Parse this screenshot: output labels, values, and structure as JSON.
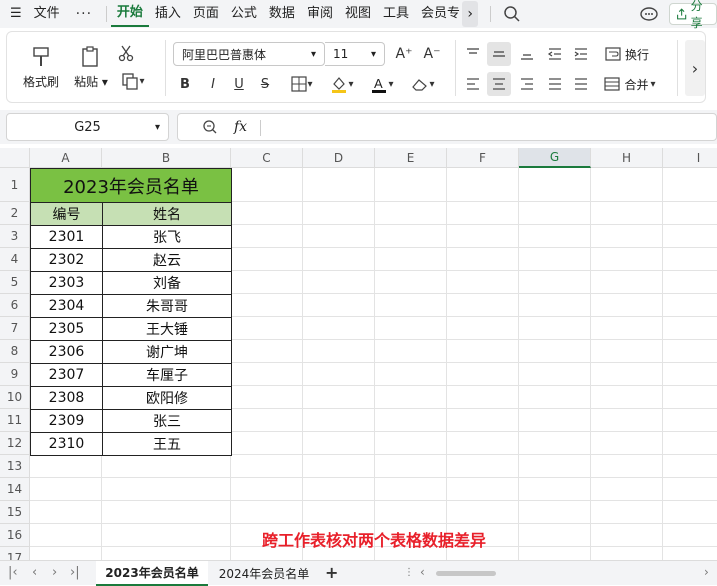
{
  "menubar": {
    "file": "文件",
    "more": "···",
    "tabs": [
      "开始",
      "插入",
      "页面",
      "公式",
      "数据",
      "审阅",
      "视图",
      "工具",
      "会员专"
    ],
    "active": "开始",
    "share": "分享"
  },
  "ribbon": {
    "format_painter": "格式刷",
    "paste": "粘贴",
    "font_name": "阿里巴巴普惠体",
    "font_size": "11",
    "font_inc": "A⁺",
    "font_dec": "A⁻",
    "bold": "B",
    "italic": "I",
    "underline": "U",
    "strike": "S",
    "wrap": "换行",
    "merge": "合并"
  },
  "formula": {
    "name_box": "G25",
    "fx": "fx",
    "value": ""
  },
  "columns": [
    "A",
    "B",
    "C",
    "D",
    "E",
    "F",
    "G",
    "H",
    "I"
  ],
  "active_column": "G",
  "rows": [
    "1",
    "2",
    "3",
    "4",
    "5",
    "6",
    "7",
    "8",
    "9",
    "10",
    "11",
    "12",
    "13",
    "14",
    "15",
    "16",
    "17"
  ],
  "table": {
    "title": "2023年会员名单",
    "headers": [
      "编号",
      "姓名"
    ],
    "data": [
      [
        "2301",
        "张飞"
      ],
      [
        "2302",
        "赵云"
      ],
      [
        "2303",
        "刘备"
      ],
      [
        "2304",
        "朱哥哥"
      ],
      [
        "2305",
        "王大锤"
      ],
      [
        "2306",
        "谢广坤"
      ],
      [
        "2307",
        "车厘子"
      ],
      [
        "2308",
        "欧阳修"
      ],
      [
        "2309",
        "张三"
      ],
      [
        "2310",
        "王五"
      ]
    ]
  },
  "caption": "跨工作表核对两个表格数据差异",
  "colors": {
    "title_fill": "#7ac143",
    "header_fill": "#c6e0b4",
    "accent": "#1a7a3c",
    "caption": "#e8202a"
  },
  "sheets": [
    "2023年会员名单",
    "2024年会员名单"
  ],
  "active_sheet": "2023年会员名单"
}
